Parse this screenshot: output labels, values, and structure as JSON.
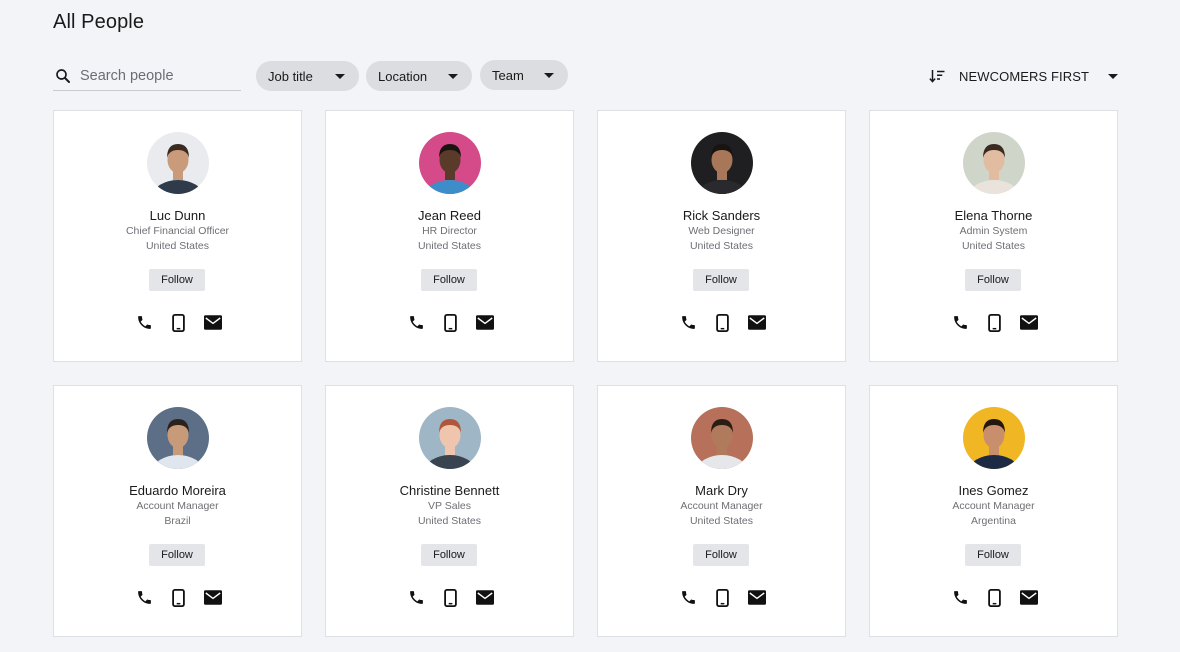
{
  "page": {
    "title": "All People"
  },
  "toolbar": {
    "search_placeholder": "Search people",
    "filters": [
      "Job title",
      "Location",
      "Team"
    ],
    "sort_label": "NEWCOMERS FIRST"
  },
  "people": [
    {
      "name": "Luc Dunn",
      "title": "Chief Financial Officer",
      "country": "United States",
      "follow": "Follow",
      "avatar_bg": "#e9ebef",
      "skin": "#c99b7a",
      "hair": "#3b2a20",
      "shirt": "#2f3a4a"
    },
    {
      "name": "Jean Reed",
      "title": "HR Director",
      "country": "United States",
      "follow": "Follow",
      "avatar_bg": "#d54a88",
      "skin": "#5a3a28",
      "hair": "#1a1410",
      "shirt": "#3d8dc9"
    },
    {
      "name": "Rick Sanders",
      "title": "Web Designer",
      "country": "United States",
      "follow": "Follow",
      "avatar_bg": "#1f1f22",
      "skin": "#a87658",
      "hair": "#181412",
      "shirt": "#2a2a2e"
    },
    {
      "name": "Elena Thorne",
      "title": "Admin System",
      "country": "United States",
      "follow": "Follow",
      "avatar_bg": "#cfd6c9",
      "skin": "#e2bca1",
      "hair": "#3a2a22",
      "shirt": "#e9e3dc"
    },
    {
      "name": "Eduardo Moreira",
      "title": "Account Manager",
      "country": "Brazil",
      "follow": "Follow",
      "avatar_bg": "#5c6f86",
      "skin": "#c79a7a",
      "hair": "#2b221e",
      "shirt": "#dfe6ee"
    },
    {
      "name": "Christine Bennett",
      "title": "VP Sales",
      "country": "United States",
      "follow": "Follow",
      "avatar_bg": "#9fb6c6",
      "skin": "#efc6ad",
      "hair": "#b0563a",
      "shirt": "#3a4450"
    },
    {
      "name": "Mark Dry",
      "title": "Account Manager",
      "country": "United States",
      "follow": "Follow",
      "avatar_bg": "#b7715a",
      "skin": "#b07a5c",
      "hair": "#2a1d16",
      "shirt": "#e6e7ea"
    },
    {
      "name": "Ines Gomez",
      "title": "Account Manager",
      "country": "Argentina",
      "follow": "Follow",
      "avatar_bg": "#f0b623",
      "skin": "#c98f6d",
      "hair": "#24170f",
      "shirt": "#1d2a44"
    }
  ]
}
